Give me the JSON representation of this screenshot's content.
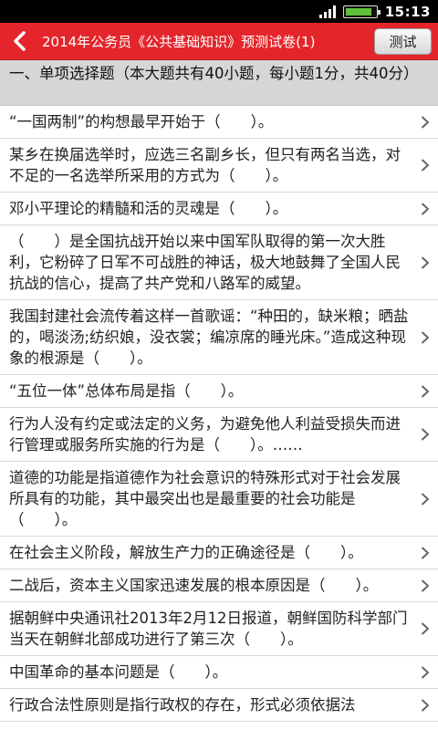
{
  "statusbar": {
    "time": "15:13"
  },
  "header": {
    "title": "2014年公务员《公共基础知识》预测试卷(1)",
    "test_button": "测试"
  },
  "section": {
    "title": "一、单项选择题（本大题共有40小题，每小题1分，共40分）"
  },
  "questions": [
    "“一国两制”的构想最早开始于（　　）。",
    "某乡在换届选举时，应选三名副乡长，但只有两名当选，对不足的一名选举所采用的方式为（　　）。",
    "邓小平理论的精髓和活的灵魂是（　　）。",
    "（　　）是全国抗战开始以来中国军队取得的第一次大胜利，它粉碎了日军不可战胜的神话，极大地鼓舞了全国人民抗战的信心，提高了共产党和八路军的威望。",
    "我国封建社会流传着这样一首歌谣：“种田的，缺米粮；晒盐的，喝淡汤;纺织娘，没衣裳；编凉席的睡光床。”造成这种现象的根源是（　　）。",
    "“五位一体”总体布局是指（　　）。",
    "行为人没有约定或法定的义务，为避免他人利益受损失而进行管理或服务所实施的行为是（　　）。……",
    "道德的功能是指道德作为社会意识的特殊形式对于社会发展所具有的功能，其中最突出也是最重要的社会功能是（　　）。",
    "在社会主义阶段，解放生产力的正确途径是（　　）。",
    "二战后，资本主义国家迅速发展的根本原因是（　　）。",
    "据朝鲜中央通讯社2013年2月12日报道，朝鲜国防科学部门当天在朝鲜北部成功进行了第三次（　　）。",
    "中国革命的基本问题是（　　）。",
    "行政合法性原则是指行政权的存在，形式必须依据法"
  ],
  "colors": {
    "titlebar": "#e4262c",
    "section_bg": "#d6d6d6",
    "chevron": "#666666"
  },
  "icons": {
    "back": "chevron-left-icon",
    "item": "chevron-right-icon"
  }
}
